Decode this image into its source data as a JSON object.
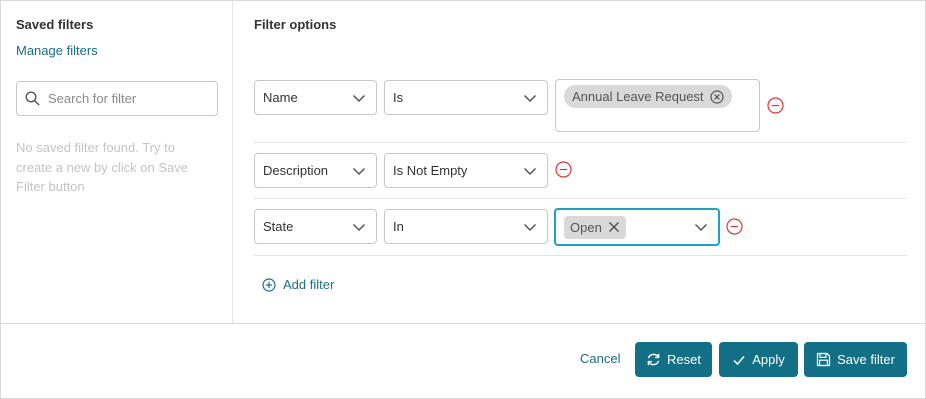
{
  "sidebar": {
    "title": "Saved filters",
    "manage_link": "Manage filters",
    "search_placeholder": "Search for filter",
    "empty_message": "No saved filter found. Try to create a new by click on Save Filter button"
  },
  "filter_options": {
    "title": "Filter options",
    "rows": [
      {
        "field": "Name",
        "operator": "Is",
        "values": [
          "Annual Leave Request"
        ]
      },
      {
        "field": "Description",
        "operator": "Is Not Empty"
      },
      {
        "field": "State",
        "operator": "In",
        "values": [
          "Open"
        ]
      }
    ],
    "add_filter_label": "Add filter"
  },
  "footer": {
    "cancel_label": "Cancel",
    "reset_label": "Reset",
    "apply_label": "Apply",
    "save_filter_label": "Save filter"
  },
  "colors": {
    "accent": "#136f85",
    "link": "#1b6e83",
    "focus_border": "#1aa3c4",
    "remove_icon": "#d9363e"
  },
  "icons": [
    "search-icon",
    "chevron-down-icon",
    "clear-chip-icon",
    "remove-filter-icon",
    "add-circle-icon",
    "refresh-icon",
    "check-icon",
    "save-icon"
  ]
}
